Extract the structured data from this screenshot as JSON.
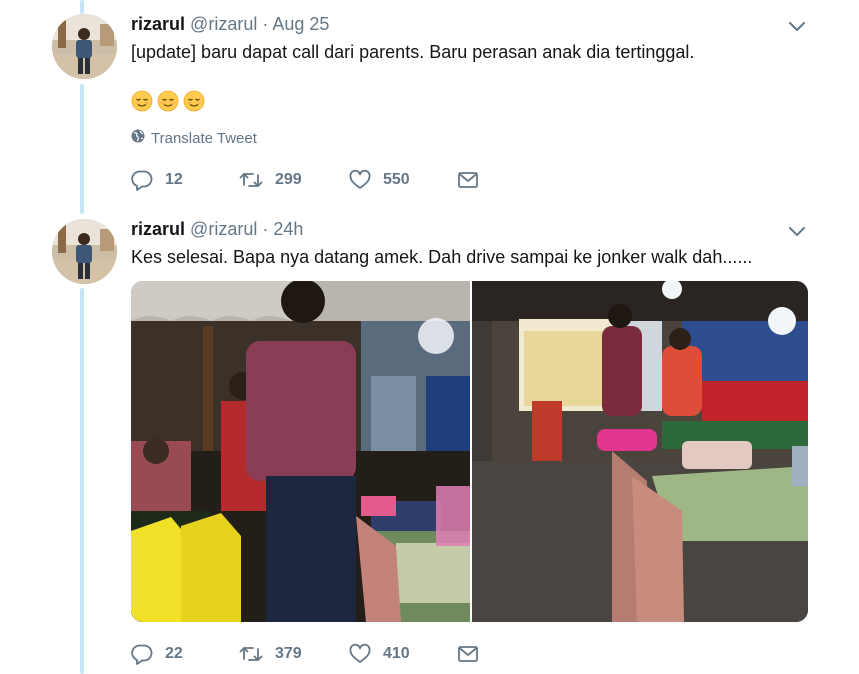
{
  "tweets": [
    {
      "name": "rizarul",
      "handle": "@rizarul",
      "separator": "·",
      "time": "Aug 25",
      "text": "[update]  baru dapat call dari parents. Baru perasan anak dia tertinggal.",
      "emojis": [
        "relieved-face",
        "relieved-face",
        "relieved-face"
      ],
      "translate_label": "Translate Tweet",
      "replies": "12",
      "retweets": "299",
      "likes": "550"
    },
    {
      "name": "rizarul",
      "handle": "@rizarul",
      "separator": "·",
      "time": "24h",
      "text": "Kes selesai. Bapa nya datang amek. Dah drive sampai ke jonker walk dah......",
      "replies": "22",
      "retweets": "379",
      "likes": "410"
    }
  ],
  "colors": {
    "thread_line": "#c4e6f7",
    "secondary_text": "#657786",
    "primary_text": "#14171a"
  }
}
